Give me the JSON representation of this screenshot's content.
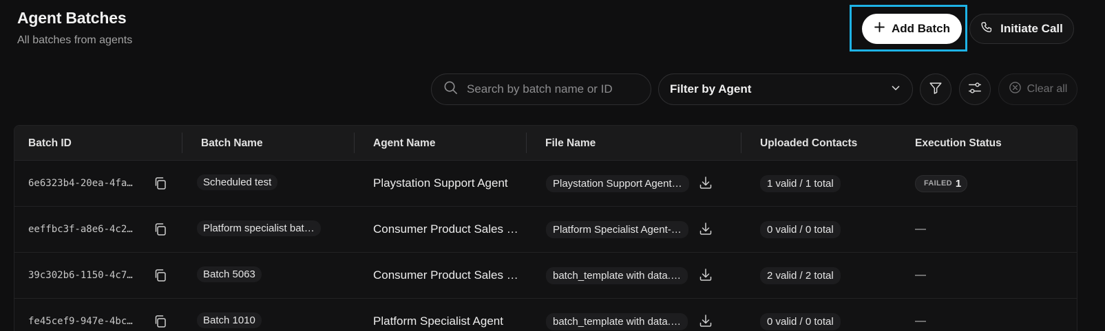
{
  "header": {
    "title": "Agent Batches",
    "subtitle": "All batches from agents",
    "add_batch_label": "Add Batch",
    "initiate_call_label": "Initiate Call"
  },
  "filters": {
    "search_placeholder": "Search by batch name or ID",
    "agent_filter_label": "Filter by Agent",
    "clear_all_label": "Clear all"
  },
  "table": {
    "columns": [
      "Batch ID",
      "Batch Name",
      "Agent Name",
      "File Name",
      "Uploaded Contacts",
      "Execution Status"
    ],
    "rows": [
      {
        "batch_id": "6e6323b4-20ea-4fa…",
        "batch_name": "Scheduled test",
        "agent_name": "Playstation Support Agent",
        "file_name": "Playstation Support Agent…",
        "contacts": "1 valid / 1 total",
        "status_label": "FAILED",
        "status_count": "1",
        "status": "failed"
      },
      {
        "batch_id": "eeffbc3f-a8e6-4c2…",
        "batch_name": "Platform specialist bat…",
        "agent_name": "Consumer Product Sales …",
        "file_name": "Platform Specialist Agent-…",
        "contacts": "0 valid / 0 total",
        "status_label": "—",
        "status": "none"
      },
      {
        "batch_id": "39c302b6-1150-4c7…",
        "batch_name": "Batch 5063",
        "agent_name": "Consumer Product Sales …",
        "file_name": "batch_template with data.…",
        "contacts": "2 valid / 2 total",
        "status_label": "—",
        "status": "none"
      },
      {
        "batch_id": "fe45cef9-947e-4bc…",
        "batch_name": "Batch 1010",
        "agent_name": "Platform Specialist Agent",
        "file_name": "batch_template with data.…",
        "contacts": "0 valid / 0 total",
        "status_label": "—",
        "status": "none"
      }
    ]
  },
  "colors": {
    "background": "#0f0f10",
    "highlight": "#1eb3e6",
    "primary_button": "#ffffff"
  },
  "icons": {
    "add": "plus-icon",
    "call": "phone-icon",
    "search": "search-icon",
    "dropdown": "chevron-down-icon",
    "filter": "funnel-icon",
    "settings": "sliders-icon",
    "clear": "x-circle-icon",
    "copy": "copy-icon",
    "download": "download-icon"
  }
}
